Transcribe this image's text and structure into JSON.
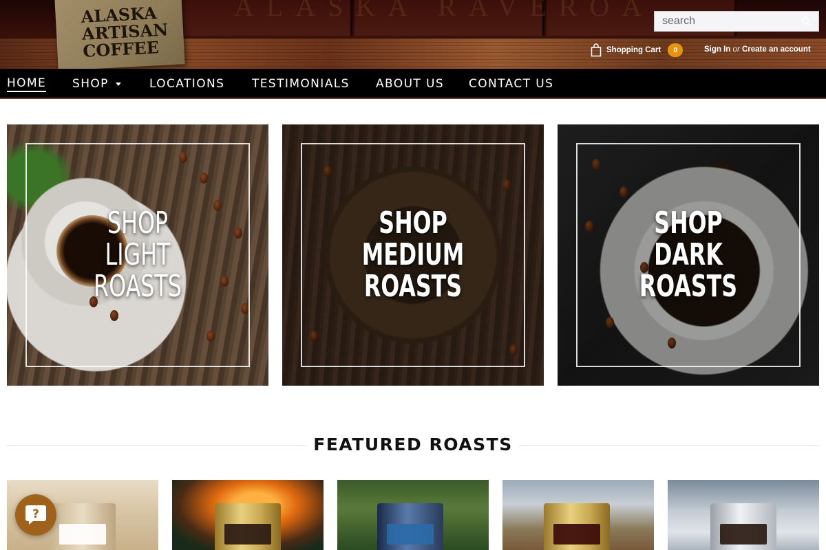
{
  "header": {
    "logo_lines": [
      "ALASKA",
      "ARTISAN",
      "COFFEE"
    ],
    "ghost_sign": "ALASKA RAVEROA",
    "search": {
      "placeholder": "search"
    },
    "cart": {
      "label": "Shopping Cart",
      "count": "0"
    },
    "account": {
      "sign_in": "Sign In",
      "or": "or",
      "create": "Create an account"
    }
  },
  "nav": {
    "items": [
      {
        "label": "HOME",
        "active": true
      },
      {
        "label": "SHOP",
        "has_dropdown": true
      },
      {
        "label": "LOCATIONS"
      },
      {
        "label": "TESTIMONIALS"
      },
      {
        "label": "ABOUT US"
      },
      {
        "label": "CONTACT US"
      }
    ]
  },
  "banners": [
    {
      "lines": [
        "SHOP",
        "LIGHT",
        "ROASTS"
      ]
    },
    {
      "lines": [
        "SHOP",
        "MEDIUM",
        "ROASTS"
      ]
    },
    {
      "lines": [
        "SHOP",
        "DARK",
        "ROASTS"
      ]
    }
  ],
  "featured": {
    "title": "FEATURED ROASTS"
  },
  "colors": {
    "accent": "#e89310",
    "chat": "#a0621a",
    "nav_bg": "#000000"
  }
}
